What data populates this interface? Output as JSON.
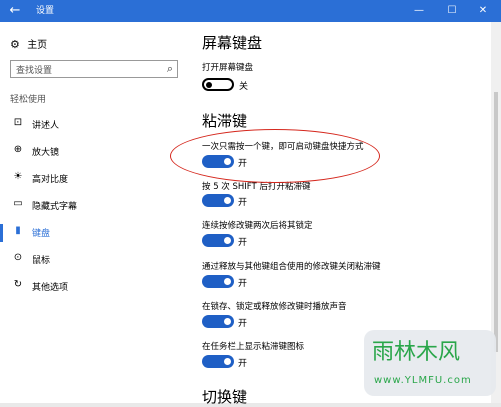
{
  "titlebar": {
    "title": "设置",
    "back": "←",
    "minimize": "—",
    "maximize": "☐",
    "close": "✕"
  },
  "sidebar": {
    "home": "主页",
    "search_placeholder": "查找设置",
    "section": "轻松使用",
    "items": [
      {
        "label": "讲述人",
        "icon": "narrator-icon",
        "glyph": "⊡"
      },
      {
        "label": "放大镜",
        "icon": "magnifier-icon",
        "glyph": "⊕"
      },
      {
        "label": "高对比度",
        "icon": "contrast-icon",
        "glyph": "☀"
      },
      {
        "label": "隐藏式字幕",
        "icon": "captions-icon",
        "glyph": "▭"
      },
      {
        "label": "键盘",
        "icon": "keyboard-icon",
        "glyph": "▮",
        "active": true
      },
      {
        "label": "鼠标",
        "icon": "mouse-icon",
        "glyph": "⊙"
      },
      {
        "label": "其他选项",
        "icon": "other-options-icon",
        "glyph": "↻"
      }
    ]
  },
  "content": {
    "onscreen_keyboard": {
      "heading": "屏幕键盘",
      "label": "打开屏幕键盘",
      "state": "关",
      "on": false
    },
    "sticky_keys": {
      "heading": "粘滞键",
      "settings": [
        {
          "label": "一次只需按一个键，即可启动键盘快捷方式",
          "state": "开",
          "on": true
        },
        {
          "label": "按 5 次 SHIFT 后打开粘滞键",
          "state": "开",
          "on": true
        },
        {
          "label": "连续按修改键两次后将其锁定",
          "state": "开",
          "on": true
        },
        {
          "label": "通过释放与其他键组合使用的修改键关闭粘滞键",
          "state": "开",
          "on": true
        },
        {
          "label": "在锁存、锁定或释放修改键时播放声音",
          "state": "开",
          "on": true
        },
        {
          "label": "在任务栏上显示粘滞键图标",
          "state": "开",
          "on": true
        }
      ]
    },
    "next_heading_partial": "切换键"
  },
  "watermark": {
    "title": "雨林木风",
    "url": "www.YLMFU.com"
  },
  "colors": {
    "accent": "#2b6fd6",
    "toggle_on": "#1f5fc5",
    "annotation": "#d5281e",
    "watermark": "#2aa64a"
  }
}
